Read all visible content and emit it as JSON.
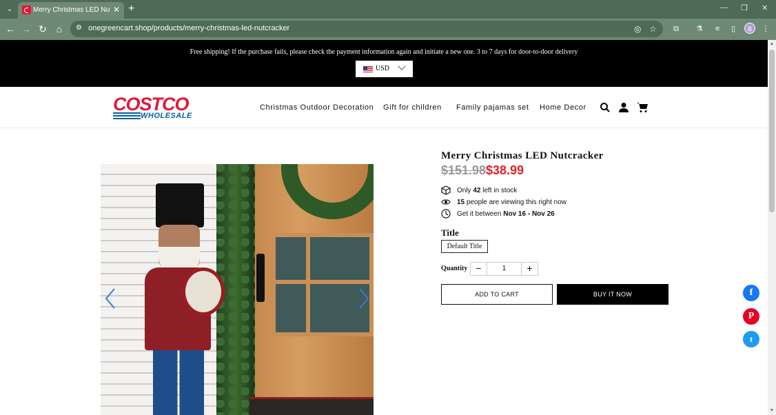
{
  "browser": {
    "tab_title": "Merry Christmas LED Nutcracke",
    "url": "onegreencart.shop/products/merry-christmas-led-nutcracker",
    "profile_initial": "B"
  },
  "announcement": {
    "text": "Free shipping! If the purchase fails, please check the payment information again and initiate a new one. 3 to 7 days for door-to-door delivery",
    "currency": "USD"
  },
  "header": {
    "logo_top": "COSTCO",
    "logo_bottom": "WHOLESALE",
    "nav": [
      "Christmas Outdoor Decoration",
      "Gift for children",
      "Family pajamas set",
      "Home Decor"
    ]
  },
  "product": {
    "title": "Merry Christmas LED Nutcracker",
    "compare_price": "$151.98",
    "price": "$38.99",
    "stock_pre": "Only",
    "stock_count": "42",
    "stock_post": "left in stock",
    "viewers_count": "15",
    "viewers_post": "people are viewing this right now",
    "delivery_pre": "Get it between",
    "delivery_range": "Nov 16 - Nov 26",
    "option_label": "Title",
    "option_value": "Default Title",
    "quantity_label": "Quantity",
    "quantity": "1",
    "add_to_cart": "ADD TO CART",
    "buy_now": "BUY IT NOW"
  },
  "colors": {
    "brand_red": "#e31837",
    "brand_blue": "#0060a9",
    "price_red": "#e1232b",
    "facebook": "#1877f2",
    "pinterest": "#e60023",
    "twitter": "#1d9bf0"
  },
  "social": [
    {
      "name": "facebook-icon",
      "glyph": "f"
    },
    {
      "name": "pinterest-icon",
      "glyph": "P"
    },
    {
      "name": "twitter-icon",
      "glyph": "t"
    }
  ]
}
